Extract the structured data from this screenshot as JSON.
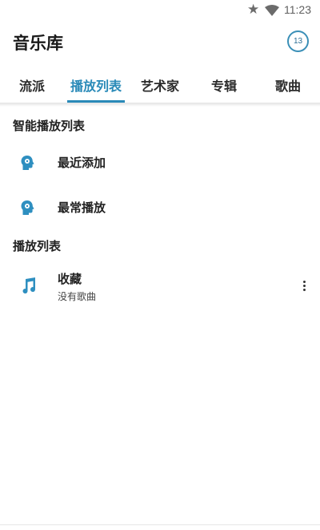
{
  "status_bar": {
    "time": "11:23",
    "icons": [
      "star-icon",
      "wifi-icon"
    ]
  },
  "header": {
    "title": "音乐库",
    "badge_count": "13"
  },
  "tabs": [
    {
      "label": "流派",
      "active": false
    },
    {
      "label": "播放列表",
      "active": true
    },
    {
      "label": "艺术家",
      "active": false
    },
    {
      "label": "专辑",
      "active": false
    },
    {
      "label": "歌曲",
      "active": false
    }
  ],
  "smart_playlists": {
    "title": "智能播放列表",
    "items": [
      {
        "label": "最近添加",
        "icon": "smart-head-icon"
      },
      {
        "label": "最常播放",
        "icon": "smart-head-icon"
      }
    ]
  },
  "playlists": {
    "title": "播放列表",
    "items": [
      {
        "label": "收藏",
        "subtitle": "没有歌曲",
        "icon": "music-note-icon"
      }
    ]
  },
  "colors": {
    "accent": "#2a8ab8",
    "icon_blue": "#2e8fc0"
  }
}
